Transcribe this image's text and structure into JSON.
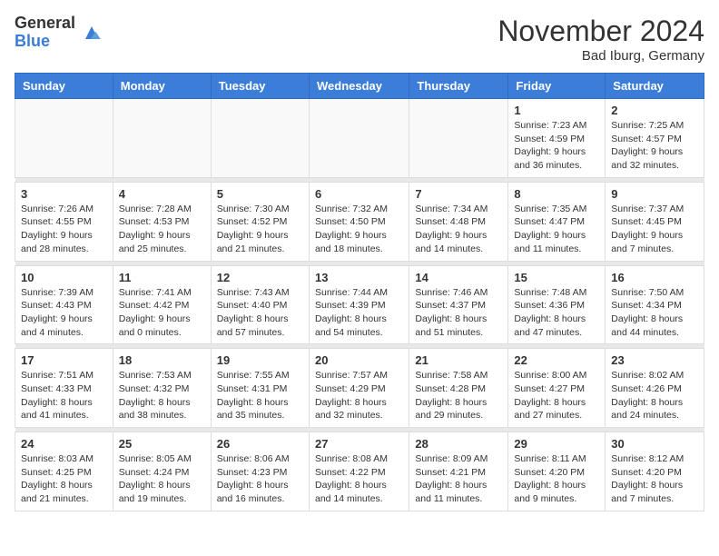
{
  "logo": {
    "general": "General",
    "blue": "Blue"
  },
  "title": "November 2024",
  "location": "Bad Iburg, Germany",
  "days_header": [
    "Sunday",
    "Monday",
    "Tuesday",
    "Wednesday",
    "Thursday",
    "Friday",
    "Saturday"
  ],
  "weeks": [
    [
      {
        "day": "",
        "info": ""
      },
      {
        "day": "",
        "info": ""
      },
      {
        "day": "",
        "info": ""
      },
      {
        "day": "",
        "info": ""
      },
      {
        "day": "",
        "info": ""
      },
      {
        "day": "1",
        "info": "Sunrise: 7:23 AM\nSunset: 4:59 PM\nDaylight: 9 hours and 36 minutes."
      },
      {
        "day": "2",
        "info": "Sunrise: 7:25 AM\nSunset: 4:57 PM\nDaylight: 9 hours and 32 minutes."
      }
    ],
    [
      {
        "day": "3",
        "info": "Sunrise: 7:26 AM\nSunset: 4:55 PM\nDaylight: 9 hours and 28 minutes."
      },
      {
        "day": "4",
        "info": "Sunrise: 7:28 AM\nSunset: 4:53 PM\nDaylight: 9 hours and 25 minutes."
      },
      {
        "day": "5",
        "info": "Sunrise: 7:30 AM\nSunset: 4:52 PM\nDaylight: 9 hours and 21 minutes."
      },
      {
        "day": "6",
        "info": "Sunrise: 7:32 AM\nSunset: 4:50 PM\nDaylight: 9 hours and 18 minutes."
      },
      {
        "day": "7",
        "info": "Sunrise: 7:34 AM\nSunset: 4:48 PM\nDaylight: 9 hours and 14 minutes."
      },
      {
        "day": "8",
        "info": "Sunrise: 7:35 AM\nSunset: 4:47 PM\nDaylight: 9 hours and 11 minutes."
      },
      {
        "day": "9",
        "info": "Sunrise: 7:37 AM\nSunset: 4:45 PM\nDaylight: 9 hours and 7 minutes."
      }
    ],
    [
      {
        "day": "10",
        "info": "Sunrise: 7:39 AM\nSunset: 4:43 PM\nDaylight: 9 hours and 4 minutes."
      },
      {
        "day": "11",
        "info": "Sunrise: 7:41 AM\nSunset: 4:42 PM\nDaylight: 9 hours and 0 minutes."
      },
      {
        "day": "12",
        "info": "Sunrise: 7:43 AM\nSunset: 4:40 PM\nDaylight: 8 hours and 57 minutes."
      },
      {
        "day": "13",
        "info": "Sunrise: 7:44 AM\nSunset: 4:39 PM\nDaylight: 8 hours and 54 minutes."
      },
      {
        "day": "14",
        "info": "Sunrise: 7:46 AM\nSunset: 4:37 PM\nDaylight: 8 hours and 51 minutes."
      },
      {
        "day": "15",
        "info": "Sunrise: 7:48 AM\nSunset: 4:36 PM\nDaylight: 8 hours and 47 minutes."
      },
      {
        "day": "16",
        "info": "Sunrise: 7:50 AM\nSunset: 4:34 PM\nDaylight: 8 hours and 44 minutes."
      }
    ],
    [
      {
        "day": "17",
        "info": "Sunrise: 7:51 AM\nSunset: 4:33 PM\nDaylight: 8 hours and 41 minutes."
      },
      {
        "day": "18",
        "info": "Sunrise: 7:53 AM\nSunset: 4:32 PM\nDaylight: 8 hours and 38 minutes."
      },
      {
        "day": "19",
        "info": "Sunrise: 7:55 AM\nSunset: 4:31 PM\nDaylight: 8 hours and 35 minutes."
      },
      {
        "day": "20",
        "info": "Sunrise: 7:57 AM\nSunset: 4:29 PM\nDaylight: 8 hours and 32 minutes."
      },
      {
        "day": "21",
        "info": "Sunrise: 7:58 AM\nSunset: 4:28 PM\nDaylight: 8 hours and 29 minutes."
      },
      {
        "day": "22",
        "info": "Sunrise: 8:00 AM\nSunset: 4:27 PM\nDaylight: 8 hours and 27 minutes."
      },
      {
        "day": "23",
        "info": "Sunrise: 8:02 AM\nSunset: 4:26 PM\nDaylight: 8 hours and 24 minutes."
      }
    ],
    [
      {
        "day": "24",
        "info": "Sunrise: 8:03 AM\nSunset: 4:25 PM\nDaylight: 8 hours and 21 minutes."
      },
      {
        "day": "25",
        "info": "Sunrise: 8:05 AM\nSunset: 4:24 PM\nDaylight: 8 hours and 19 minutes."
      },
      {
        "day": "26",
        "info": "Sunrise: 8:06 AM\nSunset: 4:23 PM\nDaylight: 8 hours and 16 minutes."
      },
      {
        "day": "27",
        "info": "Sunrise: 8:08 AM\nSunset: 4:22 PM\nDaylight: 8 hours and 14 minutes."
      },
      {
        "day": "28",
        "info": "Sunrise: 8:09 AM\nSunset: 4:21 PM\nDaylight: 8 hours and 11 minutes."
      },
      {
        "day": "29",
        "info": "Sunrise: 8:11 AM\nSunset: 4:20 PM\nDaylight: 8 hours and 9 minutes."
      },
      {
        "day": "30",
        "info": "Sunrise: 8:12 AM\nSunset: 4:20 PM\nDaylight: 8 hours and 7 minutes."
      }
    ]
  ]
}
